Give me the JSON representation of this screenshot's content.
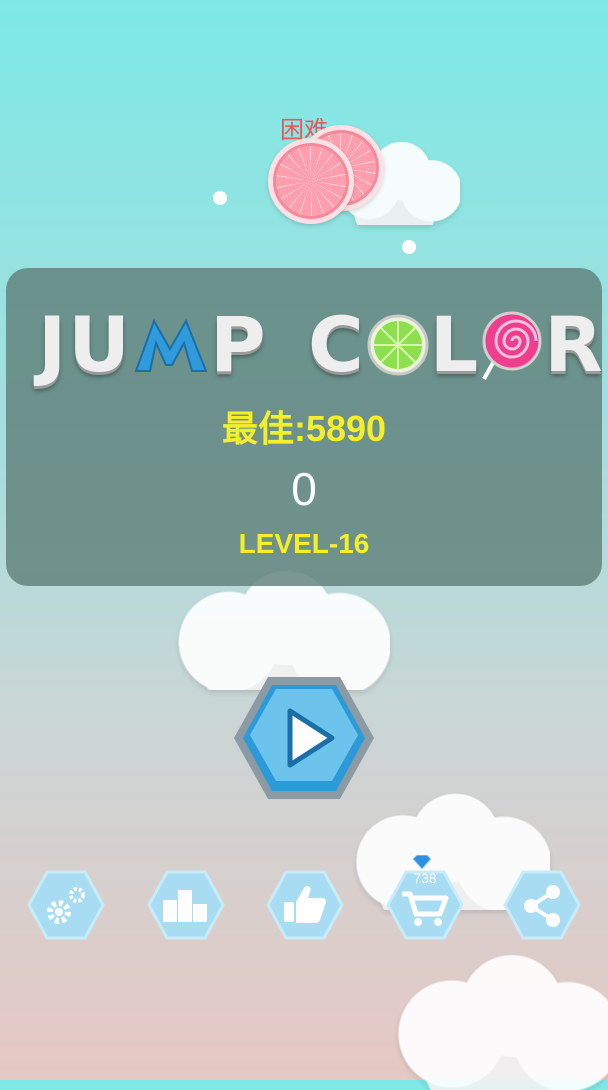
{
  "difficulty_label": "困难",
  "title": {
    "word1_prefix": "JU",
    "word1_suffix": "P",
    "word2_prefix": "C",
    "word2_mid": "L",
    "word2_suffix": "R"
  },
  "best_score_label": "最佳:5890",
  "current_score": "0",
  "level_label": "LEVEL-16",
  "gem_count": "738",
  "icons": {
    "play": "play-icon",
    "settings": "gears-icon",
    "leaderboard": "podium-icon",
    "like": "thumbs-up-icon",
    "shop": "cart-icon",
    "share": "share-icon",
    "gem": "diamond-icon"
  },
  "colors": {
    "accent_yellow": "#f5ef2a",
    "button_blue": "#6cc4ec",
    "difficulty_red": "#e65a5a"
  }
}
